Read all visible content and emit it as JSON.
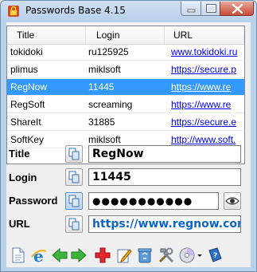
{
  "window": {
    "title": "Passwords Base 4.15"
  },
  "table": {
    "columns": [
      "Title",
      "Login",
      "URL"
    ],
    "rows": [
      {
        "title": "tokidoki",
        "login": "ru125925",
        "url": "www.tokidoki.ru",
        "selected": false
      },
      {
        "title": "plimus",
        "login": "miklsoft",
        "url": "https://secure.p",
        "selected": false
      },
      {
        "title": "RegNow",
        "login": "11445",
        "url": "https://www.re",
        "selected": true
      },
      {
        "title": "RegSoft",
        "login": "screaming",
        "url": "https://www.re",
        "selected": false
      },
      {
        "title": "ShareIt",
        "login": "31885",
        "url": "https://secure.e",
        "selected": false
      },
      {
        "title": "SoftKey",
        "login": "miklsoft",
        "url": "http://www.soft.",
        "selected": false
      }
    ]
  },
  "details": {
    "title_label": "Title",
    "title_value": "RegNow",
    "login_label": "Login",
    "login_value": "11445",
    "password_label": "Password",
    "password_value": "●●●●●●●●●●●",
    "url_label": "URL",
    "url_value": "https://www.regnow.com/ver"
  },
  "toolbar": {
    "icons": [
      "new-document-icon",
      "internet-explorer-icon",
      "back-arrow-icon",
      "forward-arrow-icon",
      "add-cross-icon",
      "edit-icon",
      "recycle-icon",
      "tools-icon",
      "cd-icon",
      "dropdown-icon",
      "help-book-icon"
    ]
  },
  "colors": {
    "selection": "#3399ff",
    "link": "#0000ee",
    "url_field": "#0b64c8"
  }
}
